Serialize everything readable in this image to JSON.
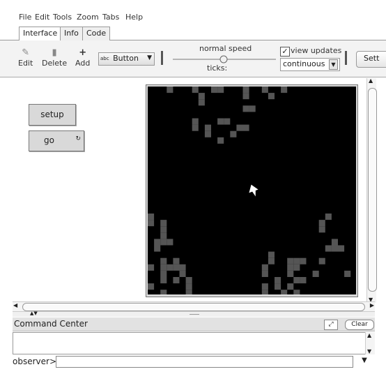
{
  "menu": [
    "File",
    "Edit",
    "Tools",
    "Zoom",
    "Tabs",
    "Help"
  ],
  "tabs": [
    "Interface",
    "Info",
    "Code"
  ],
  "toolbar": {
    "edit": "Edit",
    "delete": "Delete",
    "add": "Add",
    "widget_type": "Button",
    "widget_prefix": "abc",
    "speed_label": "normal speed",
    "ticks_label": "ticks:",
    "view_updates_label": "view updates",
    "view_updates_checked": true,
    "update_mode": "continuous",
    "settings_label": "Sett"
  },
  "buttons": {
    "setup": "setup",
    "go": "go"
  },
  "command_center": {
    "title": "Command Center",
    "clear": "Clear",
    "prompt": "observer>"
  },
  "colors": {
    "patch": "#555555",
    "world_bg": "#000000",
    "turtle": "#ffffff"
  }
}
